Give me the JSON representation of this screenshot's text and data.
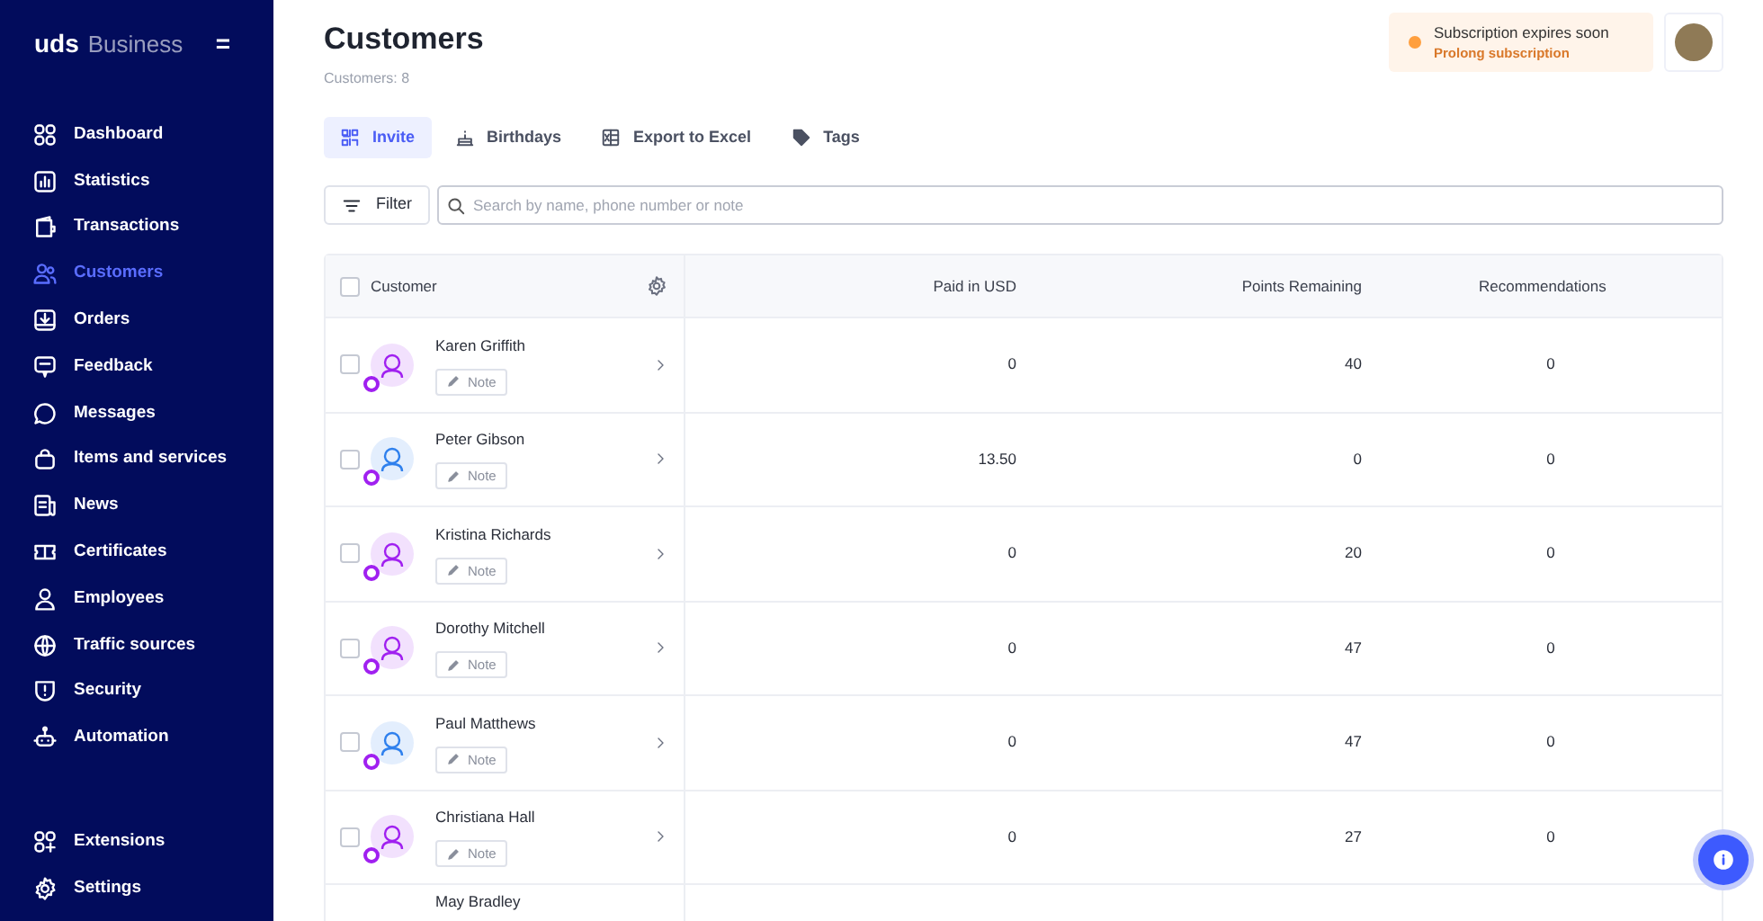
{
  "sidebar": {
    "logo": "uds",
    "logo_suffix": "Business",
    "menu_icon": "=",
    "items": [
      {
        "label": "Dashboard",
        "selected": false
      },
      {
        "label": "Statistics",
        "selected": false
      },
      {
        "label": "Transactions",
        "selected": false
      },
      {
        "label": "Customers",
        "selected": true
      },
      {
        "label": "Orders",
        "selected": false
      },
      {
        "label": "Feedback",
        "selected": false
      },
      {
        "label": "Messages",
        "selected": false
      },
      {
        "label": "Items and services",
        "selected": false
      },
      {
        "label": "News",
        "selected": false
      },
      {
        "label": "Certificates",
        "selected": false
      },
      {
        "label": "Employees",
        "selected": false
      },
      {
        "label": "Traffic sources",
        "selected": false
      },
      {
        "label": "Security",
        "selected": false
      },
      {
        "label": "Automation",
        "selected": false
      }
    ],
    "bottom_items": [
      {
        "label": "Extensions",
        "selected": false
      },
      {
        "label": "Settings",
        "selected": false
      }
    ]
  },
  "header": {
    "title": "Customers",
    "subtitle": "Customers: 8"
  },
  "notice": {
    "title": "Subscription expires soon",
    "link": "Prolong subscription"
  },
  "actions": [
    {
      "label": "Invite",
      "selected": true
    },
    {
      "label": "Birthdays",
      "selected": false
    },
    {
      "label": "Export to Excel",
      "selected": false
    },
    {
      "label": "Tags",
      "selected": false
    }
  ],
  "filter": {
    "label": "Filter"
  },
  "search": {
    "placeholder": "Search by name, phone number or note"
  },
  "table": {
    "columns": [
      "Customer",
      "Paid in USD",
      "Points Remaining",
      "Recommendations"
    ],
    "select_all_checked": false,
    "rows": [
      {
        "name": "Karen Griffith",
        "note": "Note",
        "paid": "0",
        "points": "40",
        "recommendations": "0",
        "color": "#a020f0",
        "checked": false
      },
      {
        "name": "Peter Gibson",
        "note": "Note",
        "paid": "13.50",
        "points": "0",
        "recommendations": "0",
        "color": "#2f80ed",
        "checked": false
      },
      {
        "name": "Kristina Richards",
        "note": "Note",
        "paid": "0",
        "points": "20",
        "recommendations": "0",
        "color": "#a020f0",
        "checked": false
      },
      {
        "name": "Dorothy Mitchell",
        "note": "Note",
        "paid": "0",
        "points": "47",
        "recommendations": "0",
        "color": "#a020f0",
        "checked": false
      },
      {
        "name": "Paul Matthews",
        "note": "Note",
        "paid": "0",
        "points": "47",
        "recommendations": "0",
        "color": "#2f80ed",
        "checked": false
      },
      {
        "name": "Christiana Hall",
        "note": "Note",
        "paid": "0",
        "points": "27",
        "recommendations": "0",
        "color": "#a020f0",
        "checked": false
      },
      {
        "name": "May Bradley"
      }
    ]
  }
}
